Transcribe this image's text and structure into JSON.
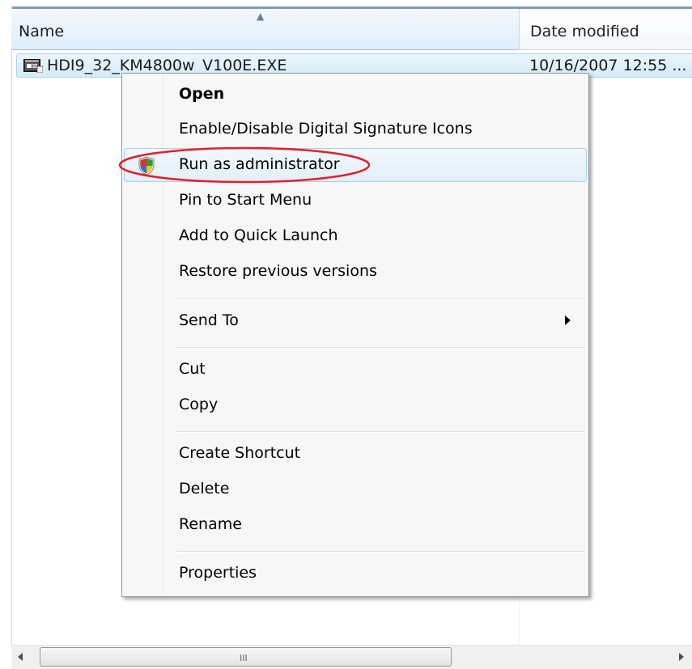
{
  "columns": {
    "name": "Name",
    "date_modified": "Date modified"
  },
  "file": {
    "name": "HDI9_32_KM4800w_V100E.EXE",
    "date": "10/16/2007 12:55 ...",
    "icon": "executable-icon"
  },
  "context_menu": {
    "open": "Open",
    "digital_signature": "Enable/Disable Digital Signature Icons",
    "run_as_admin": "Run as administrator",
    "pin_start": "Pin to Start Menu",
    "quick_launch": "Add to Quick Launch",
    "restore_versions": "Restore previous versions",
    "send_to": "Send To",
    "cut": "Cut",
    "copy": "Copy",
    "create_shortcut": "Create Shortcut",
    "delete": "Delete",
    "rename": "Rename",
    "properties": "Properties"
  },
  "icons": {
    "uac_shield": "uac-shield-icon",
    "submenu_arrow": "chevron-right-icon"
  },
  "colors": {
    "highlight_ellipse": "#e0202a",
    "selection": "#d5ebfa",
    "menu_background": "#f7f7f7"
  },
  "scrollbar": {
    "grip": "III"
  }
}
